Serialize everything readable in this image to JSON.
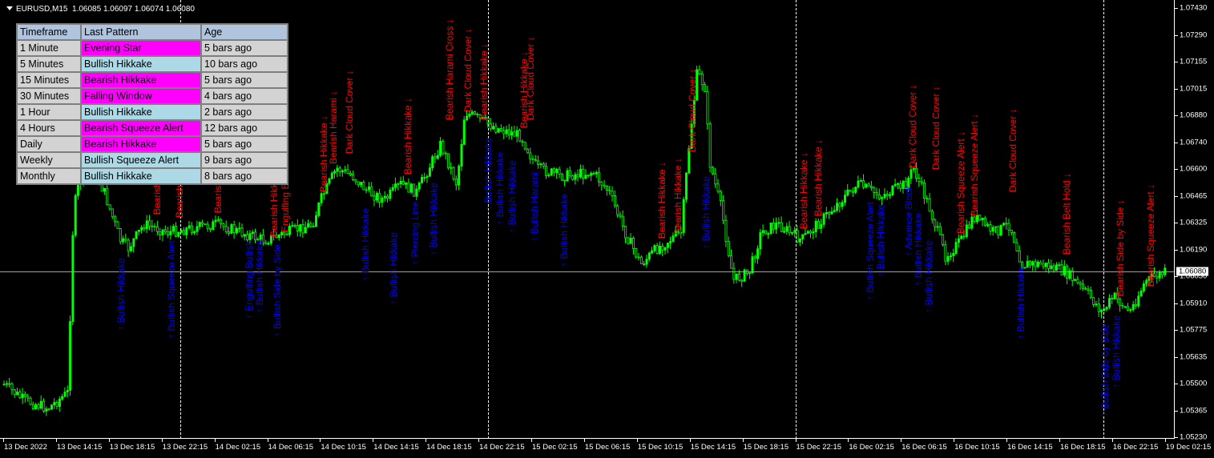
{
  "header": {
    "symbol": "EURUSD,M15",
    "ohlc": "1.06085 1.06097 1.06074 1.06080"
  },
  "table": {
    "headers": [
      "Timeframe",
      "Last Pattern",
      "Age"
    ],
    "rows": [
      {
        "tf": "1 Minute",
        "pattern": "Evening Star",
        "age": "5 bars ago",
        "type": "bear"
      },
      {
        "tf": "5 Minutes",
        "pattern": "Bullish Hikkake",
        "age": "10 bars ago",
        "type": "bull"
      },
      {
        "tf": "15 Minutes",
        "pattern": "Bearish Hikkake",
        "age": "5 bars ago",
        "type": "bear"
      },
      {
        "tf": "30 Minutes",
        "pattern": "Falling Window",
        "age": "4 bars ago",
        "type": "bear"
      },
      {
        "tf": "1 Hour",
        "pattern": "Bullish Hikkake",
        "age": "2 bars ago",
        "type": "bull"
      },
      {
        "tf": "4 Hours",
        "pattern": "Bearish Squeeze Alert",
        "age": "12 bars ago",
        "type": "bear"
      },
      {
        "tf": "Daily",
        "pattern": "Bearish Hikkake",
        "age": "5 bars ago",
        "type": "bear"
      },
      {
        "tf": "Weekly",
        "pattern": "Bullish Squeeze Alert",
        "age": "9 bars ago",
        "type": "bull"
      },
      {
        "tf": "Monthly",
        "pattern": "Bullish Hikkake",
        "age": "8 bars ago",
        "type": "bull"
      }
    ]
  },
  "colors": {
    "bear": "#ff00ff",
    "bull": "#add8e6",
    "candle": "#00ff00"
  },
  "price_axis": [
    "1.07430",
    "1.07290",
    "1.07155",
    "1.07015",
    "1.06880",
    "1.06740",
    "1.06600",
    "1.06465",
    "1.06325",
    "1.06190",
    "1.06050",
    "1.05910",
    "1.05775",
    "1.05635",
    "1.05500",
    "1.05365",
    "1.05230"
  ],
  "current_price": "1.06080",
  "time_axis": [
    "13 Dec 2022",
    "13 Dec 14:15",
    "13 Dec 18:15",
    "13 Dec 22:15",
    "14 Dec 02:15",
    "14 Dec 06:15",
    "14 Dec 10:15",
    "14 Dec 14:15",
    "14 Dec 18:15",
    "14 Dec 22:15",
    "15 Dec 02:15",
    "15 Dec 06:15",
    "15 Dec 10:15",
    "15 Dec 14:15",
    "15 Dec 18:15",
    "15 Dec 22:15",
    "16 Dec 02:15",
    "16 Dec 06:15",
    "16 Dec 10:15",
    "16 Dec 14:15",
    "16 Dec 18:15",
    "16 Dec 22:15",
    "19 Dec 02:15"
  ],
  "annotations": [
    {
      "t": "Bearish Hikkake",
      "k": "bear"
    },
    {
      "t": "Bearish Squeeze Alert",
      "k": "bear"
    },
    {
      "t": "Bearish Hikkake",
      "k": "bear"
    },
    {
      "t": "Bearish Hikkake",
      "k": "bear"
    },
    {
      "t": "Bearish Hikkake",
      "k": "bear"
    },
    {
      "t": "Engulfing Bearish",
      "k": "bear"
    },
    {
      "t": "Bearish Hikkake",
      "k": "bear"
    },
    {
      "t": "Bearish Harami",
      "k": "bear"
    },
    {
      "t": "Dark Cloud Cover",
      "k": "bear"
    },
    {
      "t": "Bearish Hikkake",
      "k": "bear"
    },
    {
      "t": "Bearish Harami Cross",
      "k": "bear"
    },
    {
      "t": "Dark Cloud Cover",
      "k": "bear"
    },
    {
      "t": "Bearish Hikkake",
      "k": "bear"
    },
    {
      "t": "Bearish Hikkake",
      "k": "bear"
    },
    {
      "t": "Dark Cloud Cover",
      "k": "bear"
    },
    {
      "t": "Bearish Hikkake",
      "k": "bear"
    },
    {
      "t": "Bearish Hikkake",
      "k": "bear"
    },
    {
      "t": "Dark Cloud Cover",
      "k": "bear"
    },
    {
      "t": "Bearish Hikkake",
      "k": "bear"
    },
    {
      "t": "Bearish Hikkake",
      "k": "bear"
    },
    {
      "t": "Dark Cloud Cover",
      "k": "bear"
    },
    {
      "t": "Dark Cloud Cover",
      "k": "bear"
    },
    {
      "t": "Bearish Squeeze Alert",
      "k": "bear"
    },
    {
      "t": "Bearish Squeeze Alert",
      "k": "bear"
    },
    {
      "t": "Dark Cloud Cover",
      "k": "bear"
    },
    {
      "t": "Bearish Belt Hold",
      "k": "bear"
    },
    {
      "t": "Bearish Side by Side",
      "k": "bear"
    },
    {
      "t": "Bearish Squeeze Alert",
      "k": "bear"
    },
    {
      "t": "Bullish Hikkake",
      "k": "bull"
    },
    {
      "t": "Bullish Squeeze Alert",
      "k": "bull"
    },
    {
      "t": "Engulfing Bullish",
      "k": "bull"
    },
    {
      "t": "Bullish Hikkake",
      "k": "bull"
    },
    {
      "t": "Bullish Side by Side",
      "k": "bull"
    },
    {
      "t": "Bullish Hikkake",
      "k": "bull"
    },
    {
      "t": "Bullish Hikkake",
      "k": "bull"
    },
    {
      "t": "Piercing Line",
      "k": "bull"
    },
    {
      "t": "Bullish Hikkake",
      "k": "bull"
    },
    {
      "t": "Bullish Hikkake",
      "k": "bull"
    },
    {
      "t": "Bullish Hikkake",
      "k": "bull"
    },
    {
      "t": "Bullish Hikkake",
      "k": "bull"
    },
    {
      "t": "Bullish Harami",
      "k": "bull"
    },
    {
      "t": "Bullish Hikkake",
      "k": "bull"
    },
    {
      "t": "Bullish Hikkake",
      "k": "bull"
    },
    {
      "t": "Bullish Squeeze Alert",
      "k": "bull"
    },
    {
      "t": "Bullish Hikkake",
      "k": "bull"
    },
    {
      "t": "Advance Block",
      "k": "bull"
    },
    {
      "t": "Bullish Hikkake",
      "k": "bull"
    },
    {
      "t": "Bullish Hikkake",
      "k": "bull"
    },
    {
      "t": "Bullish Hikkake",
      "k": "bull"
    },
    {
      "t": "Bullish Side by Side",
      "k": "bull"
    },
    {
      "t": "Bullish Hikkake",
      "k": "bull"
    }
  ]
}
